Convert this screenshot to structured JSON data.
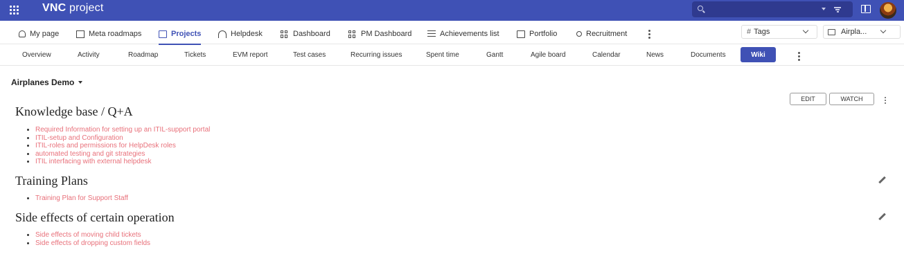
{
  "app": {
    "logo_bold": "VNC",
    "logo_rest": " project",
    "search_placeholder": ""
  },
  "main_nav": {
    "items": [
      {
        "label": "My page",
        "icon": "user-icon"
      },
      {
        "label": "Meta roadmaps",
        "icon": "map-icon"
      },
      {
        "label": "Projects",
        "icon": "folder-icon",
        "active": true
      },
      {
        "label": "Helpdesk",
        "icon": "headset-icon"
      },
      {
        "label": "Dashboard",
        "icon": "dashboard-icon"
      },
      {
        "label": "PM Dashboard",
        "icon": "dashboard-icon"
      },
      {
        "label": "Achievements list",
        "icon": "list-icon"
      },
      {
        "label": "Portfolio",
        "icon": "briefcase-icon"
      },
      {
        "label": "Recruitment",
        "icon": "add-user-icon"
      }
    ],
    "tags_label": "Tags",
    "project_select": "Airpla..."
  },
  "sub_nav": {
    "items": [
      "Overview",
      "Activity",
      "Roadmap",
      "Tickets",
      "EVM report",
      "Test cases",
      "Recurring issues",
      "Spent time",
      "Gantt",
      "Agile board",
      "Calendar",
      "News",
      "Documents"
    ],
    "active": "Wiki"
  },
  "content": {
    "project_name": "Airplanes Demo",
    "edit_label": "EDIT",
    "watch_label": "WATCH",
    "sections": [
      {
        "title": "Knowledge base / Q+A",
        "links": [
          "Required Information for setting up an ITIL-support portal",
          "ITIL-setup and Configuration",
          "ITIL-roles and permissions for HelpDesk roles",
          "automated testing and git strategies",
          "ITIL interfacing with external helpdesk"
        ]
      },
      {
        "title": "Training Plans",
        "links": [
          "Training Plan for Support Staff"
        ]
      },
      {
        "title": "Side effects of certain operation",
        "links": [
          "Side effects of moving child tickets",
          "Side effects of dropping custom fields"
        ]
      }
    ]
  },
  "colors": {
    "brand": "#3f51b5",
    "link": "#e8707a"
  }
}
